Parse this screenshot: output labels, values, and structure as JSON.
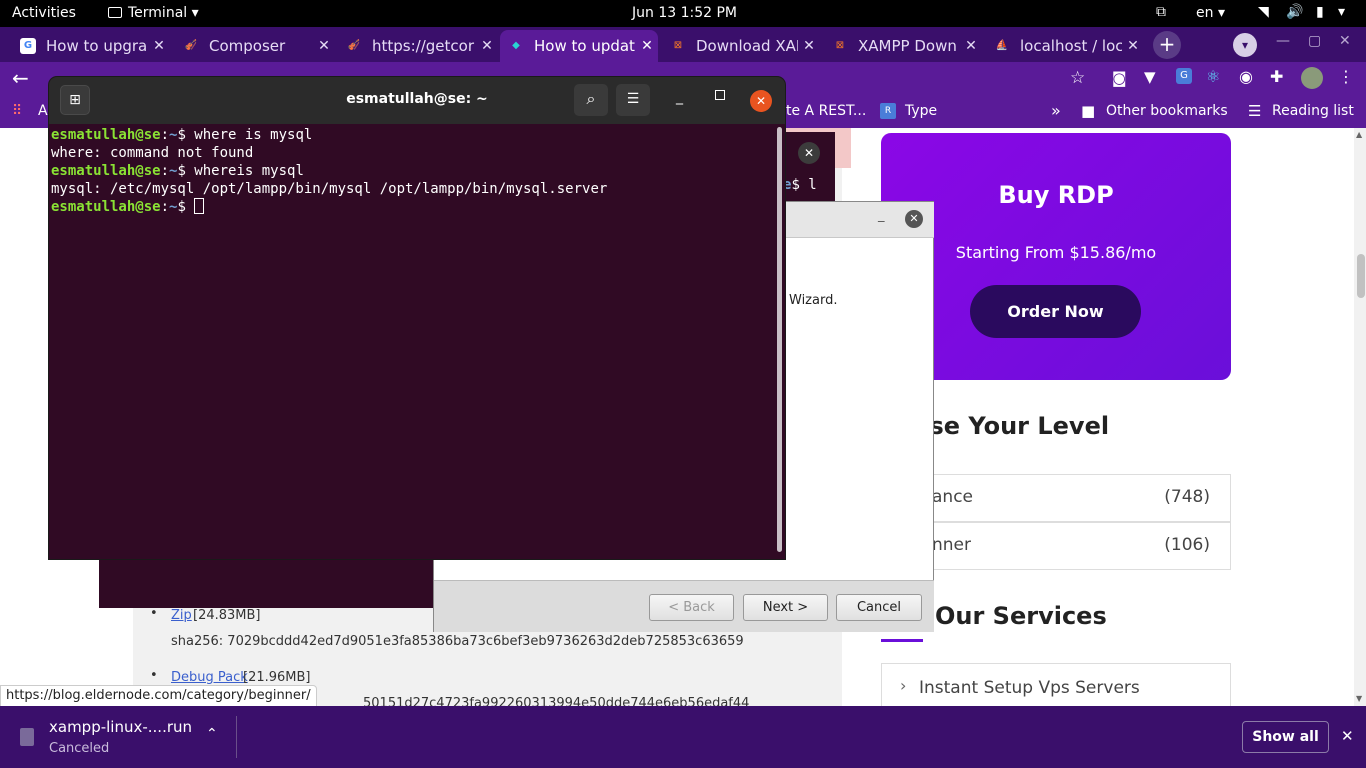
{
  "topbar": {
    "activities": "Activities",
    "app": "Terminal",
    "datetime": "Jun 13  1:52 PM",
    "lang": "en"
  },
  "tabs": [
    {
      "label": "How to upgra",
      "fav": "G",
      "color": "#ffffff"
    },
    {
      "label": "Composer",
      "fav": "🎻",
      "color": "#e7d2a8"
    },
    {
      "label": "https://getcor",
      "fav": "🎻",
      "color": "#e7d2a8"
    },
    {
      "label": "How to updat",
      "fav": "◆",
      "color": "#29d3d3"
    },
    {
      "label": "Download XAI",
      "fav": "⊠",
      "color": "#fb7a24"
    },
    {
      "label": "XAMPP Down",
      "fav": "⊠",
      "color": "#fb7a24"
    },
    {
      "label": "localhost / loc",
      "fav": "⛵",
      "color": "#f0a030"
    }
  ],
  "bookmarks": {
    "rest": "te A REST...",
    "type": "Type",
    "other": "Other bookmarks",
    "reading": "Reading list",
    "apps": "A"
  },
  "terminal": {
    "title": "esmatullah@se: ~",
    "lines": [
      {
        "prompt": "esmatullah@se",
        "cmd": "$ where is mysql"
      },
      {
        "out": "where: command not found"
      },
      {
        "prompt": "esmatullah@se",
        "cmd": "$ whereis mysql"
      },
      {
        "out": "mysql: /etc/mysql /opt/lampp/bin/mysql /opt/lampp/bin/mysql.server"
      },
      {
        "prompt": "esmatullah@se",
        "cmd": "$ "
      }
    ],
    "bg_tail": "$ l"
  },
  "wizard": {
    "text": "Wizard.",
    "back": "< Back",
    "next": "Next >",
    "cancel": "Cancel"
  },
  "promo": {
    "title": "Buy RDP",
    "subtitle": "Starting From $15.86/mo",
    "cta": "Order Now"
  },
  "levels": {
    "heading": "ose Your Level",
    "items": [
      {
        "label": "ance",
        "count": "(748)"
      },
      {
        "label": "nner",
        "count": "(106)"
      }
    ]
  },
  "services": {
    "heading": "Our Services",
    "item": "Instant Setup Vps Servers"
  },
  "downloads": [
    {
      "name": "Zip",
      "size": "[24.83MB]",
      "hash": "sha256: 7029bcddd42ed7d9051e3fa85386ba73c6bef3eb9736263d2deb725853c63659"
    },
    {
      "name": "Debug Pack",
      "size": "[21.96MB]",
      "hash": "50151d27c4723fa992260313994e50dde744e6eb56edaf44"
    }
  ],
  "statusurl": "https://blog.eldernode.com/category/beginner/",
  "download_item": {
    "name": "xampp-linux-....run",
    "status": "Canceled",
    "showall": "Show all"
  }
}
